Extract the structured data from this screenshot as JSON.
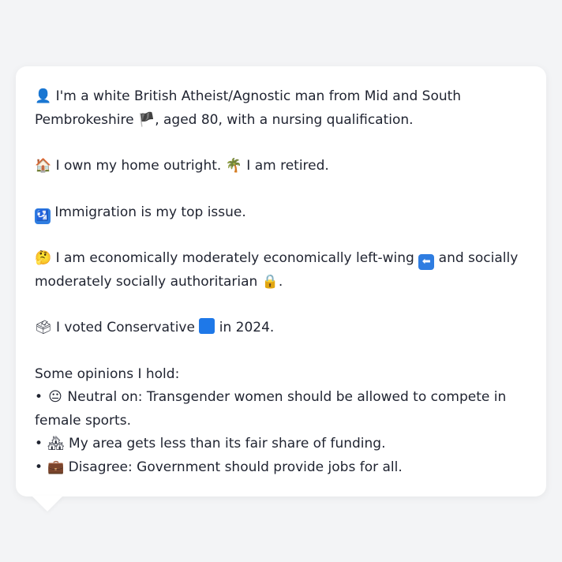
{
  "bio": {
    "p1_icon": "👤",
    "p1_a": " I'm a white British Atheist/Agnostic man from Mid and South Pembrokeshire ",
    "p1_flag": "🏴",
    "p1_b": ", aged 80, with a nursing qualification.",
    "p2_home": "🏠",
    "p2_a": " I own my home outright. ",
    "p2_palm": "🌴",
    "p2_b": " I am retired.",
    "p3_icon": "🛂",
    "p3_text": " Immigration is my top issue.",
    "p4_icon": "🤔",
    "p4_a": " I am economically moderately economically left-wing ",
    "p4_arrow": "⬅",
    "p4_b": " and socially moderately socially authoritarian ",
    "p4_lock": "🔒",
    "p4_c": ".",
    "p5_icon": "🗳",
    "p5_a": " I voted Conservative ",
    "p5_b": " in 2024.",
    "opinions_heading": "Some opinions I hold:",
    "opinions": [
      {
        "bullet": "•",
        "icon": "😐",
        "text": " Neutral on: Transgender women should be allowed to compete in female sports."
      },
      {
        "bullet": "•",
        "icon": "🏘",
        "text": " My area gets less than its fair share of funding."
      },
      {
        "bullet": "•",
        "icon": "💼",
        "text": " Disagree: Government should provide jobs for all."
      }
    ]
  },
  "colors": {
    "background": "#f3f4f6",
    "card": "#ffffff",
    "text": "#1f2330",
    "conservative_blue": "#1e78e8"
  }
}
